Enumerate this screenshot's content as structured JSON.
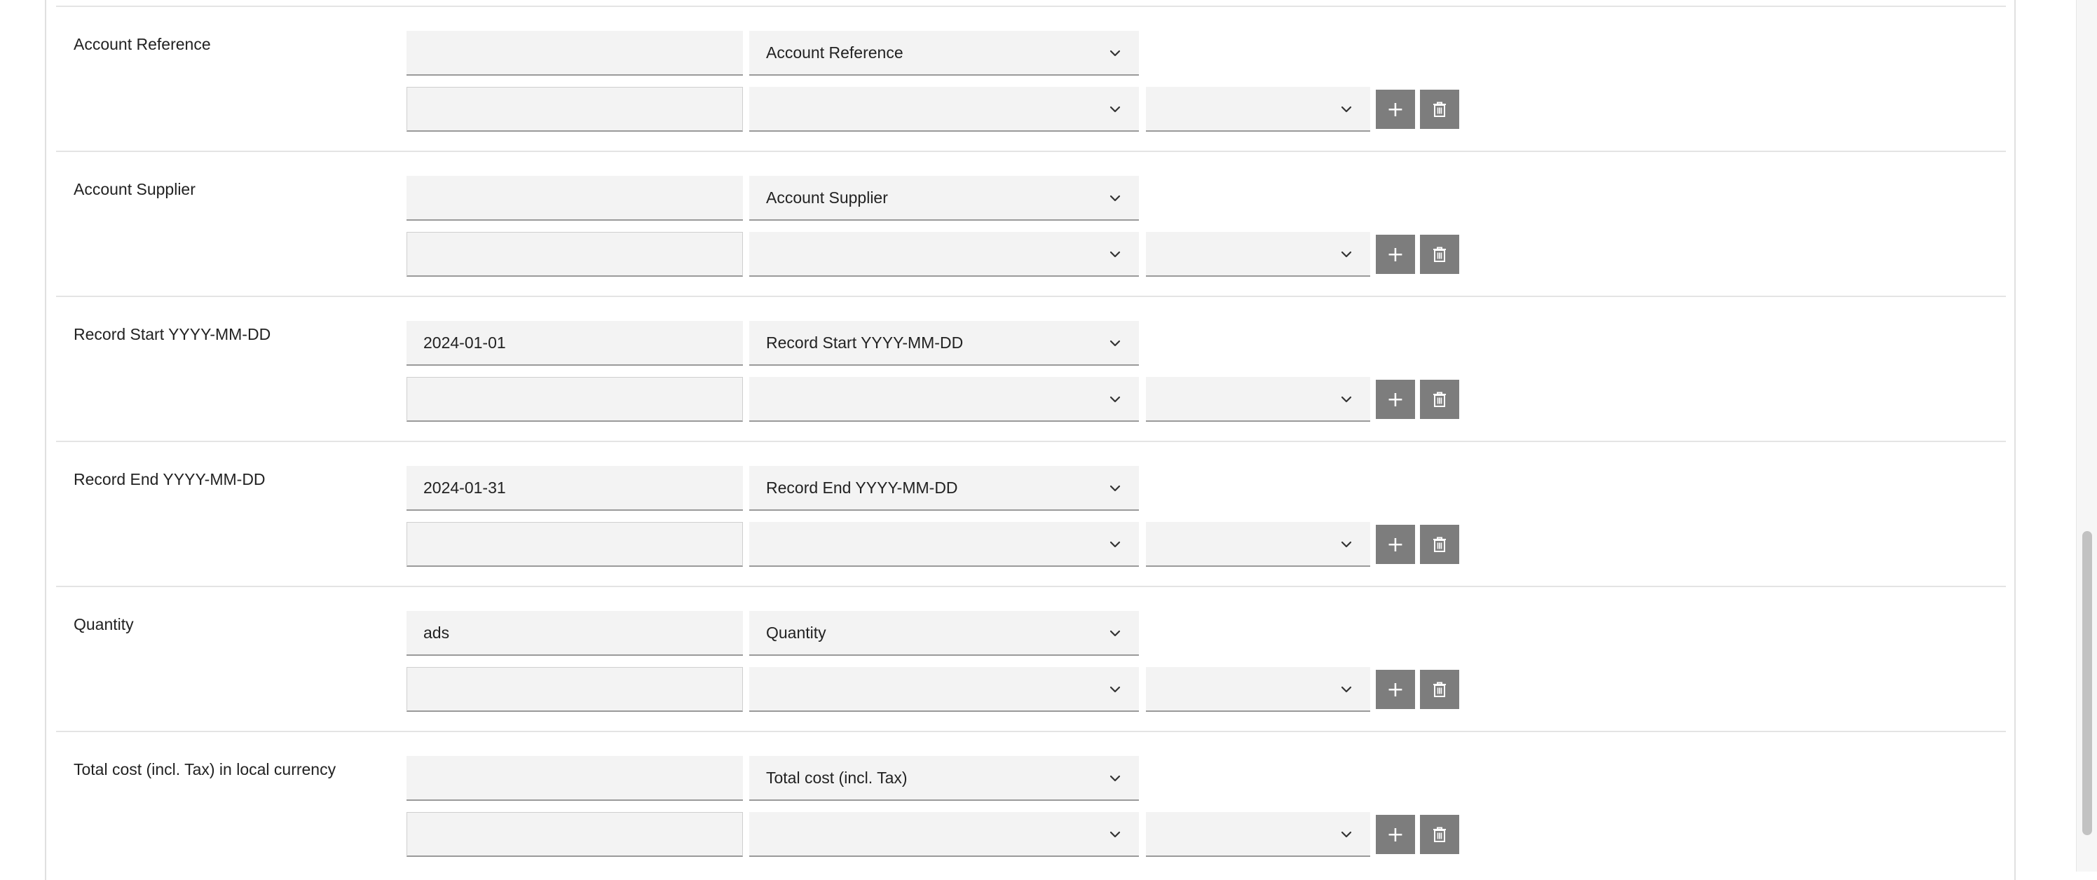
{
  "rows": [
    {
      "label": "Account Reference",
      "value": "",
      "mapping": "Account Reference",
      "sub_value": "",
      "sub_mapping": "",
      "sub_op": ""
    },
    {
      "label": "Account Supplier",
      "value": "",
      "mapping": "Account Supplier",
      "sub_value": "",
      "sub_mapping": "",
      "sub_op": ""
    },
    {
      "label": "Record Start YYYY-MM-DD",
      "value": "2024-01-01",
      "mapping": "Record Start YYYY-MM-DD",
      "sub_value": "",
      "sub_mapping": "",
      "sub_op": ""
    },
    {
      "label": "Record End YYYY-MM-DD",
      "value": "2024-01-31",
      "mapping": "Record End YYYY-MM-DD",
      "sub_value": "",
      "sub_mapping": "",
      "sub_op": ""
    },
    {
      "label": "Quantity",
      "value": "ads",
      "mapping": "Quantity",
      "sub_value": "",
      "sub_mapping": "",
      "sub_op": ""
    },
    {
      "label": "Total cost (incl. Tax) in local currency",
      "value": "",
      "mapping": "Total cost (incl. Tax)",
      "sub_value": "",
      "sub_mapping": "",
      "sub_op": ""
    }
  ],
  "buttons": {
    "add_label": "+",
    "delete_icon": "trash-icon"
  },
  "icons": {
    "dropdown": "chevron-down-icon"
  },
  "colors": {
    "button_bg": "#7d7d7d",
    "field_bg": "#f3f3f3",
    "divider": "#e4e4e4"
  }
}
